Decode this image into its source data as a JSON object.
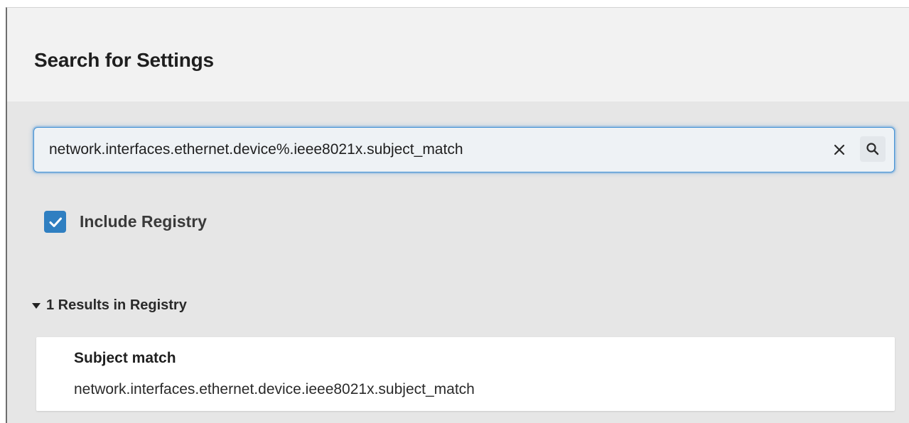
{
  "header": {
    "title": "Search for Settings"
  },
  "search": {
    "value": "network.interfaces.ethernet.device%.ieee8021x.subject_match",
    "clear_icon": "close-icon",
    "search_icon": "search-icon"
  },
  "include_registry": {
    "label": "Include Registry",
    "checked": true
  },
  "results": {
    "header": "1 Results in Registry",
    "expanded": true,
    "items": [
      {
        "title": "Subject match",
        "path": "network.interfaces.ethernet.device.ieee8021x.subject_match"
      }
    ]
  },
  "colors": {
    "accent": "#2f7fc1",
    "focus_ring": "#3e8fd4",
    "header_bg": "#f2f2f2",
    "body_bg": "#e6e6e6"
  }
}
